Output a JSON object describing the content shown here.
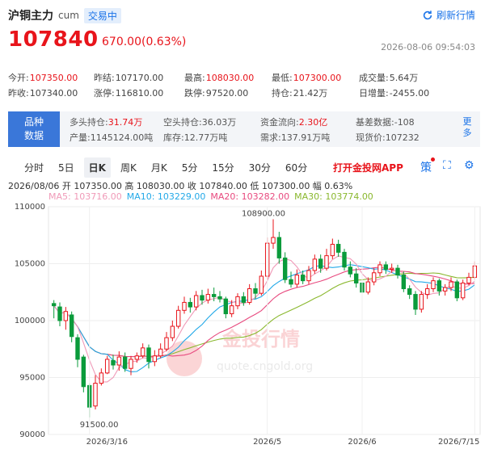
{
  "header": {
    "name": "沪铜主力",
    "code": "cum",
    "status": "交易中",
    "refresh": "刷新行情"
  },
  "quote": {
    "price": "107840",
    "change": "670.00(0.63%)",
    "time": "2026-08-06 09:54:03"
  },
  "stats": [
    [
      {
        "l": "今开:",
        "v": "107350.00",
        "c": "red"
      },
      {
        "l": "昨结:",
        "v": "107170.00",
        "c": ""
      },
      {
        "l": "最高:",
        "v": "108030.00",
        "c": "red"
      },
      {
        "l": "最低:",
        "v": "107300.00",
        "c": "red"
      },
      {
        "l": "成交量:",
        "v": "5.64万",
        "c": ""
      }
    ],
    [
      {
        "l": "昨收:",
        "v": "107340.00",
        "c": ""
      },
      {
        "l": "涨停:",
        "v": "116810.00",
        "c": ""
      },
      {
        "l": "跌停:",
        "v": "97520.00",
        "c": ""
      },
      {
        "l": "持仓:",
        "v": "21.42万",
        "c": ""
      },
      {
        "l": "日增量:",
        "v": "-2455.00",
        "c": ""
      }
    ]
  ],
  "info": {
    "label1": "品种",
    "label2": "数据",
    "more": "更多",
    "row1": [
      {
        "l": "多头持仓:",
        "v": "31.74万",
        "c": "red"
      },
      {
        "l": "空头持仓:",
        "v": "36.03万",
        "c": ""
      },
      {
        "l": "资金流向:",
        "v": "2.30亿",
        "c": "red"
      },
      {
        "l": "基差数据:",
        "v": "-108",
        "c": ""
      }
    ],
    "row2": [
      {
        "l": "产量:",
        "v": "1145124.00吨",
        "c": ""
      },
      {
        "l": "库存:",
        "v": "12.77万吨",
        "c": ""
      },
      {
        "l": "需求:",
        "v": "137.91万吨",
        "c": ""
      },
      {
        "l": "现货价:",
        "v": "107232",
        "c": ""
      }
    ]
  },
  "tabs": [
    "分时",
    "5日",
    "日K",
    "周K",
    "月K",
    "5分",
    "15分",
    "30分",
    "60分"
  ],
  "active_tab": "日K",
  "promo": "打开金投网APP",
  "ohlc_line": "2026/08/06 开 107350.00 高 108030.00 收 107840.00 低 107300.00 幅 0.63%",
  "ma": [
    {
      "t": "MA5: 103716.00",
      "c": "#f09ab8"
    },
    {
      "t": "MA10: 103229.00",
      "c": "#23a9e8"
    },
    {
      "t": "MA20: 103282.00",
      "c": "#e84a7f"
    },
    {
      "t": "MA30: 103774.00",
      "c": "#8ab82e"
    }
  ],
  "watermark": {
    "name": "金投行情",
    "url": "quote.cngold.org"
  },
  "chart_data": {
    "type": "candlestick",
    "y_ticks": [
      "110000",
      "105000",
      "100000",
      "95000",
      "90000"
    ],
    "ylim": [
      90000,
      110000
    ],
    "x_ticks": [
      "2026/3/16",
      "2026/5",
      "2026/6",
      "2026/7/15"
    ],
    "annotations": {
      "high": "108900.00",
      "low": "91500.00"
    },
    "colors": {
      "up": "#e8141b",
      "down": "#0a9b3b",
      "ma5": "#f09ab8",
      "ma10": "#23a9e8",
      "ma20": "#e84a7f",
      "ma30": "#8ab82e"
    },
    "candles": [
      [
        101500,
        101300,
        101800,
        100200
      ],
      [
        101200,
        100000,
        101600,
        99500
      ],
      [
        100000,
        100800,
        101200,
        99200
      ],
      [
        100500,
        98600,
        100800,
        98100
      ],
      [
        98500,
        96600,
        98800,
        95900
      ],
      [
        96800,
        94200,
        97000,
        93700
      ],
      [
        94300,
        92400,
        94500,
        91500
      ],
      [
        92500,
        94500,
        95200,
        92200
      ],
      [
        94500,
        95400,
        95800,
        94300
      ],
      [
        95400,
        96600,
        96900,
        95300
      ],
      [
        96500,
        96100,
        97000,
        95700
      ],
      [
        96100,
        96800,
        97300,
        95600
      ],
      [
        96800,
        95800,
        97200,
        95500
      ],
      [
        95800,
        96600,
        96900,
        95200
      ],
      [
        96600,
        96900,
        97200,
        96300
      ],
      [
        96900,
        97600,
        98000,
        96700
      ],
      [
        97600,
        96400,
        97900,
        95800
      ],
      [
        96400,
        96900,
        97400,
        96000
      ],
      [
        96900,
        97500,
        98000,
        96700
      ],
      [
        97500,
        98500,
        99000,
        97300
      ],
      [
        98500,
        99500,
        100000,
        98200
      ],
      [
        99500,
        100900,
        101300,
        99300
      ],
      [
        100900,
        101600,
        102100,
        100600
      ],
      [
        101600,
        101200,
        102000,
        100700
      ],
      [
        101200,
        102200,
        102600,
        100900
      ],
      [
        102200,
        101800,
        102700,
        101400
      ],
      [
        101800,
        102300,
        102800,
        101500
      ],
      [
        102300,
        102100,
        102900,
        101700
      ],
      [
        102100,
        101900,
        102600,
        101600
      ],
      [
        101900,
        100600,
        102100,
        100200
      ],
      [
        100600,
        101300,
        101800,
        100300
      ],
      [
        101300,
        102100,
        102400,
        101000
      ],
      [
        102100,
        101600,
        102500,
        101300
      ],
      [
        101600,
        102800,
        103200,
        101400
      ],
      [
        102800,
        102400,
        103300,
        101900
      ],
      [
        102400,
        103900,
        104400,
        102200
      ],
      [
        103900,
        106800,
        107300,
        103600
      ],
      [
        106800,
        107300,
        108900,
        106300
      ],
      [
        107300,
        105500,
        107800,
        105000
      ],
      [
        105500,
        103600,
        106000,
        103300
      ],
      [
        103600,
        103200,
        104300,
        102900
      ],
      [
        103200,
        104000,
        104500,
        102900
      ],
      [
        104000,
        103500,
        104400,
        103200
      ],
      [
        103500,
        104400,
        104800,
        103200
      ],
      [
        104400,
        105400,
        105800,
        104100
      ],
      [
        105400,
        104600,
        105800,
        104200
      ],
      [
        104600,
        105700,
        106300,
        104400
      ],
      [
        105700,
        106700,
        107200,
        105400
      ],
      [
        106700,
        106000,
        107100,
        105600
      ],
      [
        106000,
        104700,
        106300,
        104400
      ],
      [
        104700,
        104100,
        105200,
        103800
      ],
      [
        104100,
        103300,
        104600,
        102900
      ],
      [
        103300,
        102500,
        103600,
        101800
      ],
      [
        102500,
        103400,
        103800,
        102300
      ],
      [
        103400,
        104200,
        104600,
        103100
      ],
      [
        104200,
        104900,
        105200,
        103900
      ],
      [
        104900,
        104500,
        105200,
        104100
      ],
      [
        104500,
        104600,
        105000,
        104200
      ],
      [
        104600,
        104000,
        104900,
        103700
      ],
      [
        104000,
        102800,
        104300,
        102500
      ],
      [
        102800,
        102300,
        103100,
        101900
      ],
      [
        102300,
        101000,
        102600,
        100500
      ],
      [
        101000,
        102300,
        102600,
        100700
      ],
      [
        102300,
        102800,
        103200,
        101900
      ],
      [
        102800,
        103500,
        103800,
        102500
      ],
      [
        103500,
        102600,
        103700,
        102200
      ],
      [
        102600,
        102900,
        103200,
        102200
      ],
      [
        102900,
        103400,
        103800,
        102600
      ],
      [
        103400,
        102000,
        103600,
        101700
      ],
      [
        102000,
        103300,
        103600,
        101800
      ],
      [
        103300,
        103800,
        104200,
        103100
      ],
      [
        103800,
        104800,
        105200,
        103600
      ]
    ]
  }
}
